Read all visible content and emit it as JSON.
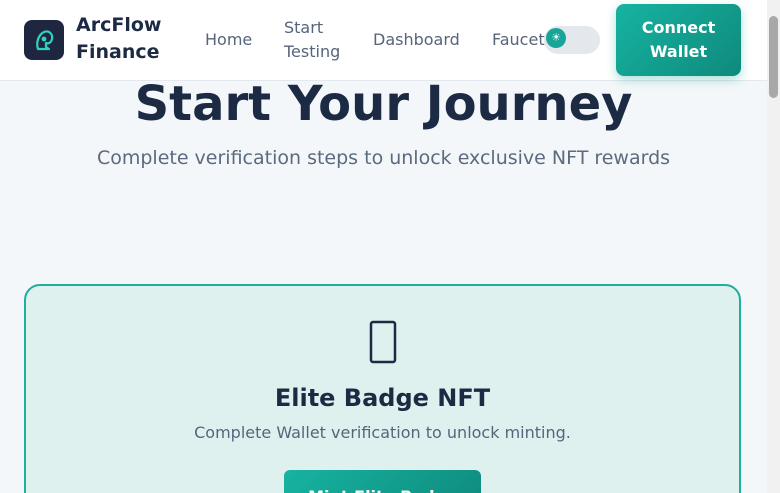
{
  "brand": {
    "name": "ArcFlow Finance",
    "logo_icon": "arc-head-icon"
  },
  "nav": {
    "home": "Home",
    "start_testing": "Start Testing",
    "dashboard": "Dashboard",
    "faucet": "Faucet"
  },
  "theme_toggle": {
    "icon": "sun-icon",
    "glyph": "☀"
  },
  "connect_wallet": "Connect Wallet",
  "hero": {
    "title": "Start Your Journey",
    "subtitle": "Complete verification steps to unlock exclusive NFT rewards"
  },
  "nft_card": {
    "icon": "missing-glyph-icon",
    "title": "Elite Badge NFT",
    "description": "Complete Wallet verification to unlock minting.",
    "button": "Mint Elite Badge"
  },
  "colors": {
    "accent": "#17a597",
    "accent_dark": "#0e8a7c",
    "text_dark": "#1c2a44",
    "text_muted": "#56657a",
    "card_bg": "#dff1ef",
    "logo_bg": "#1f2740"
  }
}
